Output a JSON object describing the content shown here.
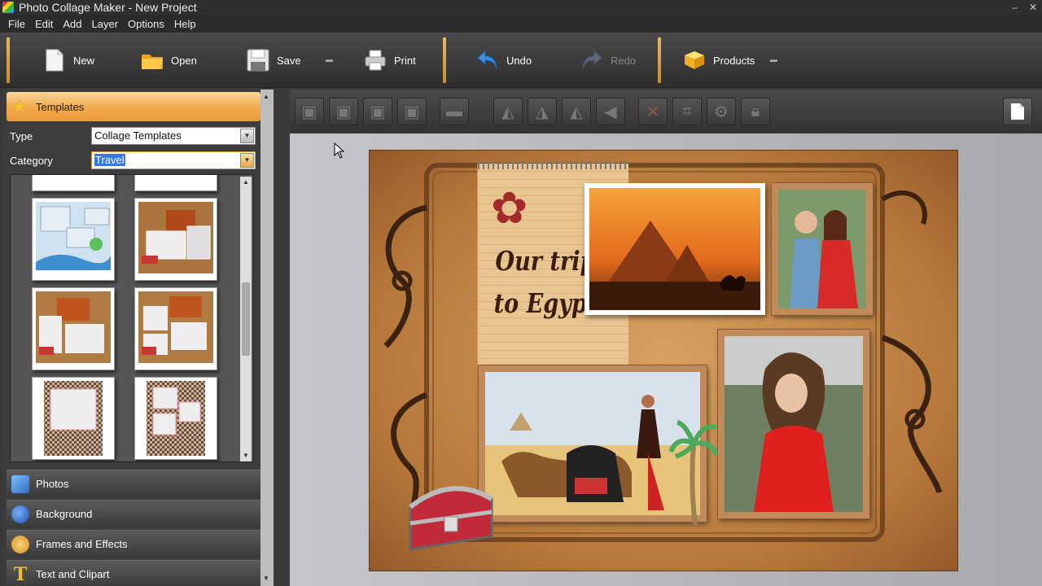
{
  "window": {
    "title": "Photo Collage Maker - New Project",
    "minimize": "–",
    "close": "✕"
  },
  "menu": [
    "File",
    "Edit",
    "Add",
    "Layer",
    "Options",
    "Help"
  ],
  "toolbar": {
    "new": "New",
    "open": "Open",
    "save": "Save",
    "print": "Print",
    "undo": "Undo",
    "redo": "Redo",
    "products": "Products",
    "dropdown_glyph": "▬"
  },
  "templates_panel": {
    "header": "Templates",
    "type_label": "Type",
    "type_value": "Collage Templates",
    "category_label": "Category",
    "category_value": "Travel"
  },
  "accordion": [
    {
      "label": "Photos",
      "icon": "photos-icon",
      "color": "#3a7bd5"
    },
    {
      "label": "Background",
      "icon": "background-icon",
      "color": "#2e6ad1"
    },
    {
      "label": "Frames and Effects",
      "icon": "palette-icon",
      "color": "#e0a030"
    },
    {
      "label": "Text and Clipart",
      "icon": "text-icon",
      "color": "#e6b422"
    }
  ],
  "edit_tools": [
    "bring-to-front-icon",
    "bring-forward-icon",
    "send-backward-icon",
    "send-to-back-icon",
    "align-icon",
    "rotate-left-icon",
    "rotate-right-icon",
    "flip-horizontal-icon",
    "flip-vertical-icon",
    "delete-icon",
    "crop-icon",
    "settings-icon",
    "lock-icon"
  ],
  "collage": {
    "caption_line1": "Our trip",
    "caption_line2": "to Egypt"
  },
  "colors": {
    "accent_orange": "#f0a94c",
    "selection_blue": "#3279e6",
    "collage_brown": "#b6783a"
  }
}
